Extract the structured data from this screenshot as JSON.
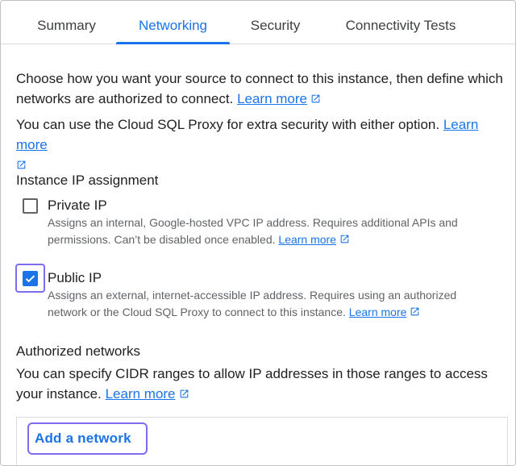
{
  "tabs": [
    {
      "label": "Summary"
    },
    {
      "label": "Networking"
    },
    {
      "label": "Security"
    },
    {
      "label": "Connectivity Tests"
    }
  ],
  "active_tab": "Networking",
  "intro": {
    "text": "Choose how you want your source to connect to this instance, then define which networks are authorized to connect.",
    "link": "Learn more"
  },
  "proxy": {
    "text": "You can use the Cloud SQL Proxy for extra security with either option.",
    "link": "Learn more"
  },
  "ip_assignment": {
    "title": "Instance IP assignment",
    "options": [
      {
        "label": "Private IP",
        "checked": false,
        "desc": "Assigns an internal, Google-hosted VPC IP address. Requires additional APIs and permissions. Can’t be disabled once enabled.",
        "link": "Learn more"
      },
      {
        "label": "Public IP",
        "checked": true,
        "desc": "Assigns an external, internet-accessible IP address. Requires using an authorized network or the Cloud SQL Proxy to connect to this instance.",
        "link": "Learn more"
      }
    ]
  },
  "authorized_networks": {
    "title": "Authorized networks",
    "text": "You can specify CIDR ranges to allow IP addresses in those ranges to access your instance.",
    "link": "Learn more",
    "add_button": "Add a network"
  },
  "colors": {
    "accent": "#1a73e8",
    "focus": "#7b6cf0",
    "text": "#202124",
    "secondary": "#5f6368"
  },
  "icons": {
    "external_link": "open-in-new-icon",
    "check": "check-icon"
  }
}
